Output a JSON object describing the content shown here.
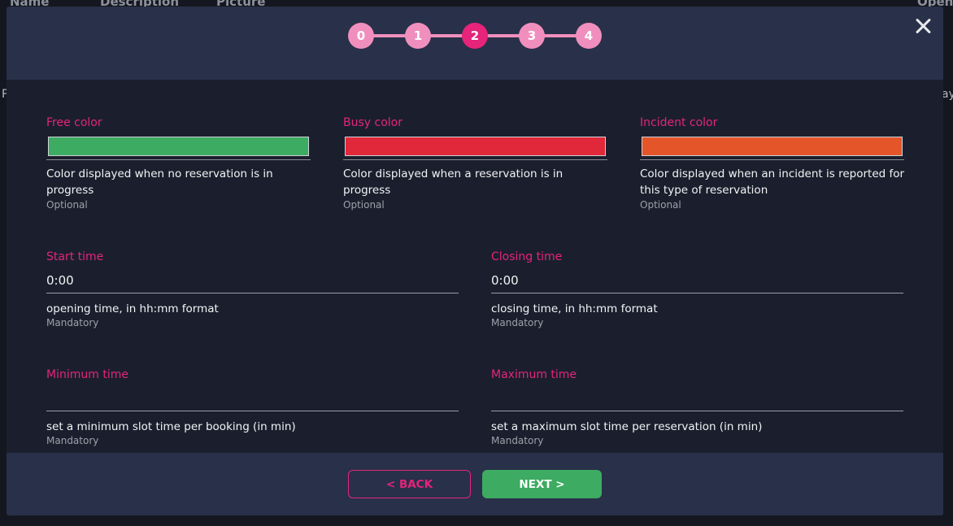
{
  "background": {
    "headers": [
      "Name",
      "Description",
      "Picture",
      "Open"
    ],
    "side_left": "P",
    "side_right": "ay"
  },
  "stepper": {
    "steps": [
      "0",
      "1",
      "2",
      "3",
      "4"
    ],
    "active": 2,
    "colors": {
      "step": "#f08fbd",
      "active": "#e5247a"
    }
  },
  "colors_section": {
    "free": {
      "label": "Free color",
      "swatch": "#3dab62",
      "help": "Color displayed when no reservation is in progress",
      "requirement": "Optional"
    },
    "busy": {
      "label": "Busy color",
      "swatch": "#e1273a",
      "help": "Color displayed when a reservation is in progress",
      "requirement": "Optional"
    },
    "incident": {
      "label": "Incident color",
      "swatch": "#e4552a",
      "help": "Color displayed when an incident is reported for this type of reservation",
      "requirement": "Optional"
    }
  },
  "start_time": {
    "label": "Start time",
    "value": "0:00",
    "help": "opening time, in hh:mm format",
    "requirement": "Mandatory"
  },
  "closing_time": {
    "label": "Closing time",
    "value": "0:00",
    "help": "closing time, in hh:mm format",
    "requirement": "Mandatory"
  },
  "minimum_time": {
    "label": "Minimum time",
    "value": "",
    "help": "set a minimum slot time per booking (in min)",
    "requirement": "Mandatory"
  },
  "maximum_time": {
    "label": "Maximum time",
    "value": "",
    "help": "set a maximum slot time per reservation (in min)",
    "requirement": "Mandatory"
  },
  "footer": {
    "back_label": "< BACK",
    "next_label": "NEXT >"
  },
  "theme": {
    "accent": "#e3257c",
    "modal_bg": "#1b1f2d",
    "header_bg": "#293049",
    "success": "#3dab62"
  }
}
